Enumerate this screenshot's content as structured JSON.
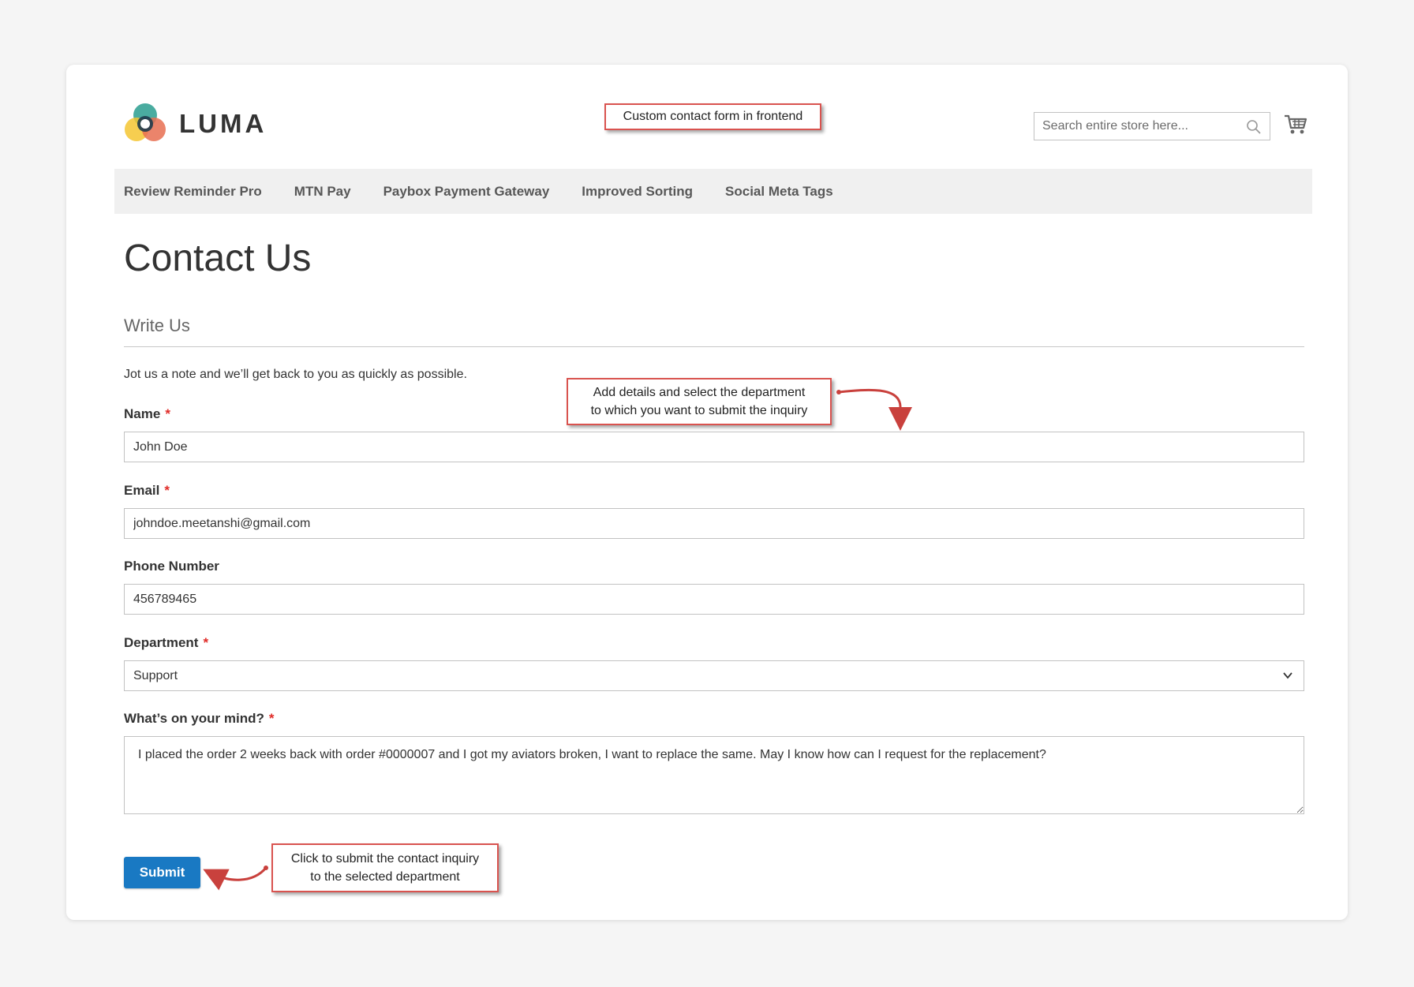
{
  "header": {
    "logo_text": "LUMA",
    "search_placeholder": "Search entire store here..."
  },
  "nav": {
    "items": [
      {
        "label": "Review Reminder Pro"
      },
      {
        "label": "MTN Pay"
      },
      {
        "label": "Paybox Payment Gateway"
      },
      {
        "label": "Improved Sorting"
      },
      {
        "label": "Social Meta Tags"
      }
    ]
  },
  "page": {
    "title": "Contact Us",
    "legend": "Write Us",
    "note": "Jot us a note and we’ll get back to you as quickly as possible."
  },
  "form": {
    "required_marker": "*",
    "name": {
      "label": "Name",
      "value": "John Doe"
    },
    "email": {
      "label": "Email",
      "value": "johndoe.meetanshi@gmail.com"
    },
    "phone": {
      "label": "Phone Number",
      "value": "456789465"
    },
    "department": {
      "label": "Department",
      "value": "Support"
    },
    "comment": {
      "label": "What’s on your mind?",
      "value": "I placed the order 2 weeks back with order #0000007 and I got my aviators broken, I want to replace the same. May I know how can I request for the replacement?"
    },
    "submit_label": "Submit"
  },
  "annotations": {
    "top": "Custom contact form in frontend",
    "details_line1": "Add details and select the department",
    "details_line2": "to  which you want to submit the inquiry",
    "submit_line1": "Click to submit the contact inquiry",
    "submit_line2": "to the selected department"
  },
  "colors": {
    "button": "#1979c3",
    "required": "#e02b27",
    "annotation_border": "#d9534f",
    "nav_bg": "#f0f0f0"
  }
}
